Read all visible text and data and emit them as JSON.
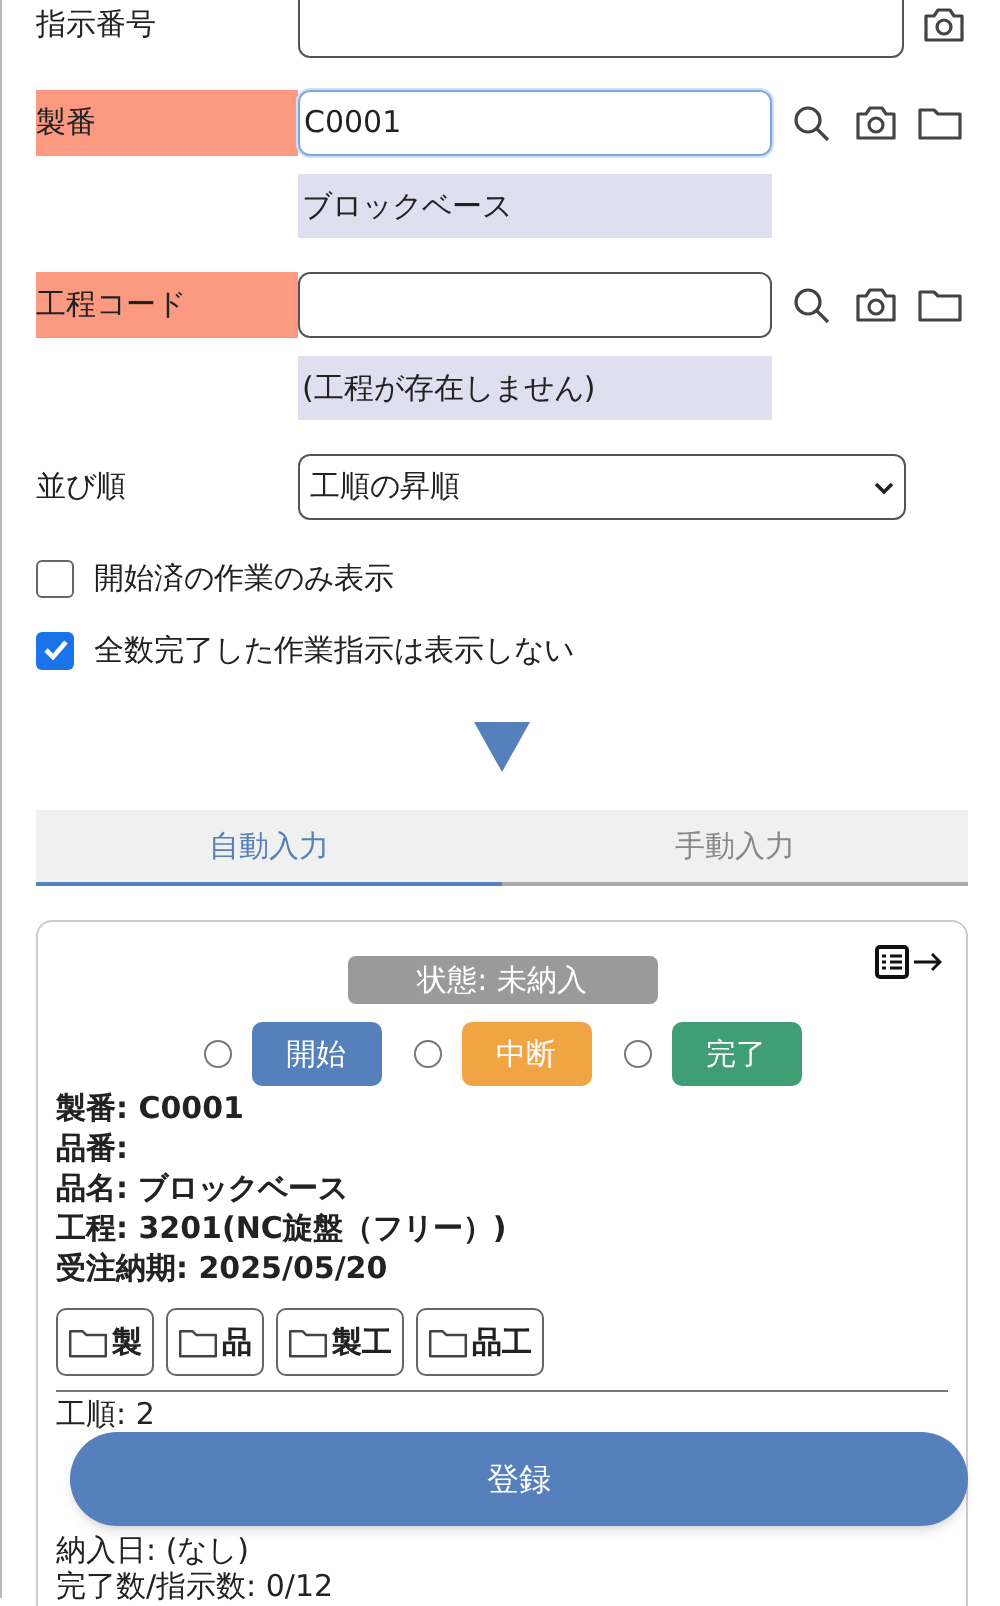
{
  "form": {
    "fields": [
      {
        "kind": "plain_input",
        "label": "指示番号",
        "required": false
      },
      {
        "kind": "lookup_input",
        "label": "製番",
        "required": true,
        "value": "C0001",
        "focused": true,
        "note": "ブロックベース"
      },
      {
        "kind": "lookup_input",
        "label": "工程コード",
        "required": true,
        "focused": false,
        "note": "(工程が存在しません)"
      },
      {
        "kind": "select",
        "label": "並び順",
        "required": false,
        "value": "工順の昇順"
      }
    ],
    "checkboxes": [
      {
        "label": "開始済の作業のみ表示",
        "checked": false
      },
      {
        "label": "全数完了した作業指示は表示しない",
        "checked": true
      }
    ]
  },
  "tabs": [
    {
      "label": "自動入力",
      "selected": true
    },
    {
      "label": "手動入力",
      "selected": false
    }
  ],
  "card": {
    "status": "状態: 未納入",
    "actions": [
      {
        "label": "開始",
        "selected": false,
        "color": "#5580bb"
      },
      {
        "label": "中断",
        "selected": false,
        "color": "#f0a444"
      },
      {
        "label": "完了",
        "selected": false,
        "color": "#3f9e74"
      }
    ],
    "summary": [
      "製番: C0001",
      "品番:",
      "品名: ブロックベース",
      "工程: 3201(NC旋盤（フリー）)",
      "受注納期: 2025/05/20"
    ],
    "folders": [
      "製",
      "品",
      "製工",
      "品工"
    ],
    "details": [
      "工順: 2",
      "納入日: (なし)",
      "完了数/指示数: 0/12"
    ]
  },
  "submit": "登録"
}
